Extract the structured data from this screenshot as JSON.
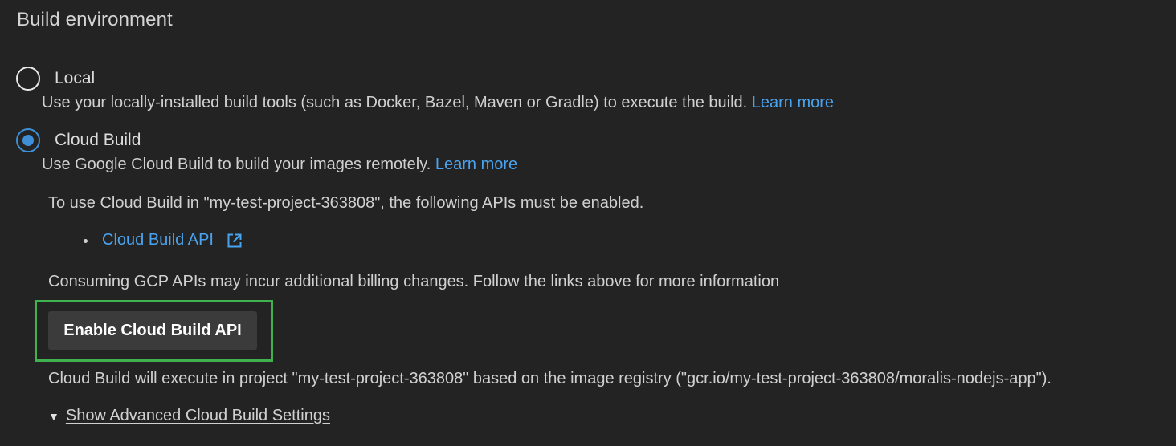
{
  "section": {
    "title": "Build environment"
  },
  "options": {
    "local": {
      "label": "Local",
      "selected": false,
      "description": "Use your locally-installed build tools (such as Docker, Bazel, Maven or Gradle) to execute the build.",
      "learn_more": "Learn more"
    },
    "cloud": {
      "label": "Cloud Build",
      "selected": true,
      "description": "Use Google Cloud Build to build your images remotely.",
      "learn_more": "Learn more"
    }
  },
  "cloud_build": {
    "apis_notice": "To use Cloud Build in \"my-test-project-363808\", the following APIs must be enabled.",
    "apis": [
      {
        "label": "Cloud Build API",
        "icon": "external-link-icon"
      }
    ],
    "billing_notice": "Consuming GCP APIs may incur additional billing changes. Follow the links above for more information",
    "enable_button": "Enable Cloud Build API",
    "project_notice": "Cloud Build will execute in project \"my-test-project-363808\" based on the image registry (\"gcr.io/my-test-project-363808/moralis-nodejs-app\").",
    "advanced_toggle": {
      "icon": "triangle-down-icon",
      "glyph": "▼",
      "label": "Show Advanced Cloud Build Settings"
    }
  },
  "colors": {
    "background": "#232323",
    "link": "#4aa3ef",
    "radio_selected": "#3e8fd8",
    "highlight_border": "#3fb14f",
    "button_bg": "#3b3b3b"
  }
}
